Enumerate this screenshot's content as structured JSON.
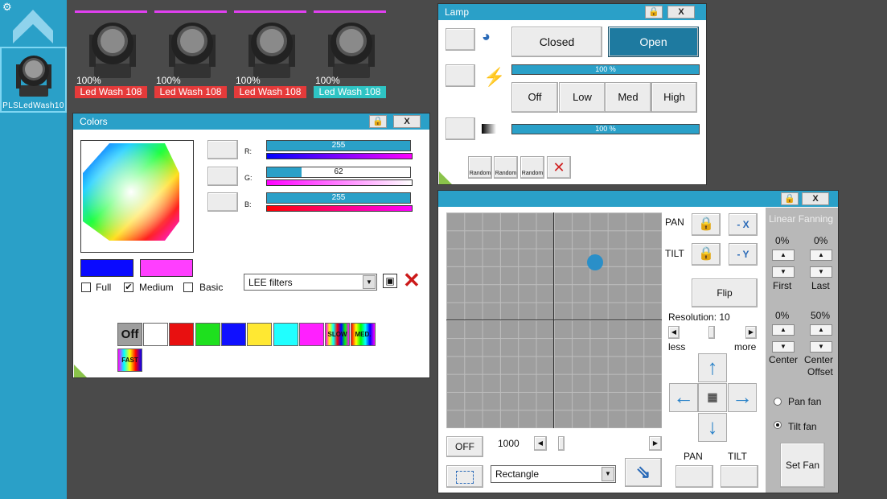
{
  "sidebar": {
    "fixture_label": "PLSLedWash10"
  },
  "fixtures": [
    {
      "percent": "100%",
      "name": "Led Wash 108",
      "color": "#e53a3a"
    },
    {
      "percent": "100%",
      "name": "Led Wash 108",
      "color": "#e53a3a"
    },
    {
      "percent": "100%",
      "name": "Led Wash 108",
      "color": "#e53a3a"
    },
    {
      "percent": "100%",
      "name": "Led Wash 108",
      "color": "#2ec4c4"
    }
  ],
  "colors_window": {
    "title": "Colors",
    "close": "X",
    "r_label": "R:",
    "g_label": "G:",
    "b_label": "B:",
    "r_value": "255",
    "g_value": "62",
    "b_value": "255",
    "r_fraction": 1.0,
    "g_fraction": 0.243,
    "b_fraction": 1.0,
    "swatch_a": "#0a0aff",
    "swatch_b": "#ff3eff",
    "full_label": "Full",
    "medium_label": "Medium",
    "basic_label": "Basic",
    "filter_value": "LEE filters",
    "presets": {
      "off": "Off",
      "slow": "SLOW",
      "med": "MED.",
      "fast": "FAST"
    },
    "preset_colors": [
      "#ffffff",
      "#e81010",
      "#1ee01e",
      "#1010ff",
      "#ffe832",
      "#20ffff",
      "#ff20ff"
    ]
  },
  "lamp_window": {
    "title": "Lamp",
    "close": "X",
    "closed_label": "Closed",
    "open_label": "Open",
    "intensity_text": "100 %",
    "intensity_fraction": 1.0,
    "off_label": "Off",
    "low_label": "Low",
    "med_label": "Med",
    "high_label": "High",
    "dimmer_text": "100 %",
    "dimmer_fraction": 1.0,
    "random_label": "Random"
  },
  "position_window": {
    "close": "X",
    "pan_label": "PAN",
    "tilt_label": "TILT",
    "neg_x": "- X",
    "neg_y": "- Y",
    "flip_label": "Flip",
    "resolution_label": "Resolution: 10",
    "less_label": "less",
    "more_label": "more",
    "off_label": "OFF",
    "speed_value": "1000",
    "shape_value": "Rectangle",
    "pan_bottom": "PAN",
    "tilt_bottom": "TILT",
    "dot_x": 0.69,
    "dot_y": 0.23
  },
  "fanning": {
    "title": "Linear Fanning",
    "first_pct": "0%",
    "last_pct": "0%",
    "first_label": "First",
    "last_label": "Last",
    "center_pct": "0%",
    "offset_pct": "50%",
    "center_label": "Center",
    "offset_label_1": "Center",
    "offset_label_2": "Offset",
    "pan_fan": "Pan fan",
    "tilt_fan": "Tilt fan",
    "set_fan": "Set Fan"
  }
}
